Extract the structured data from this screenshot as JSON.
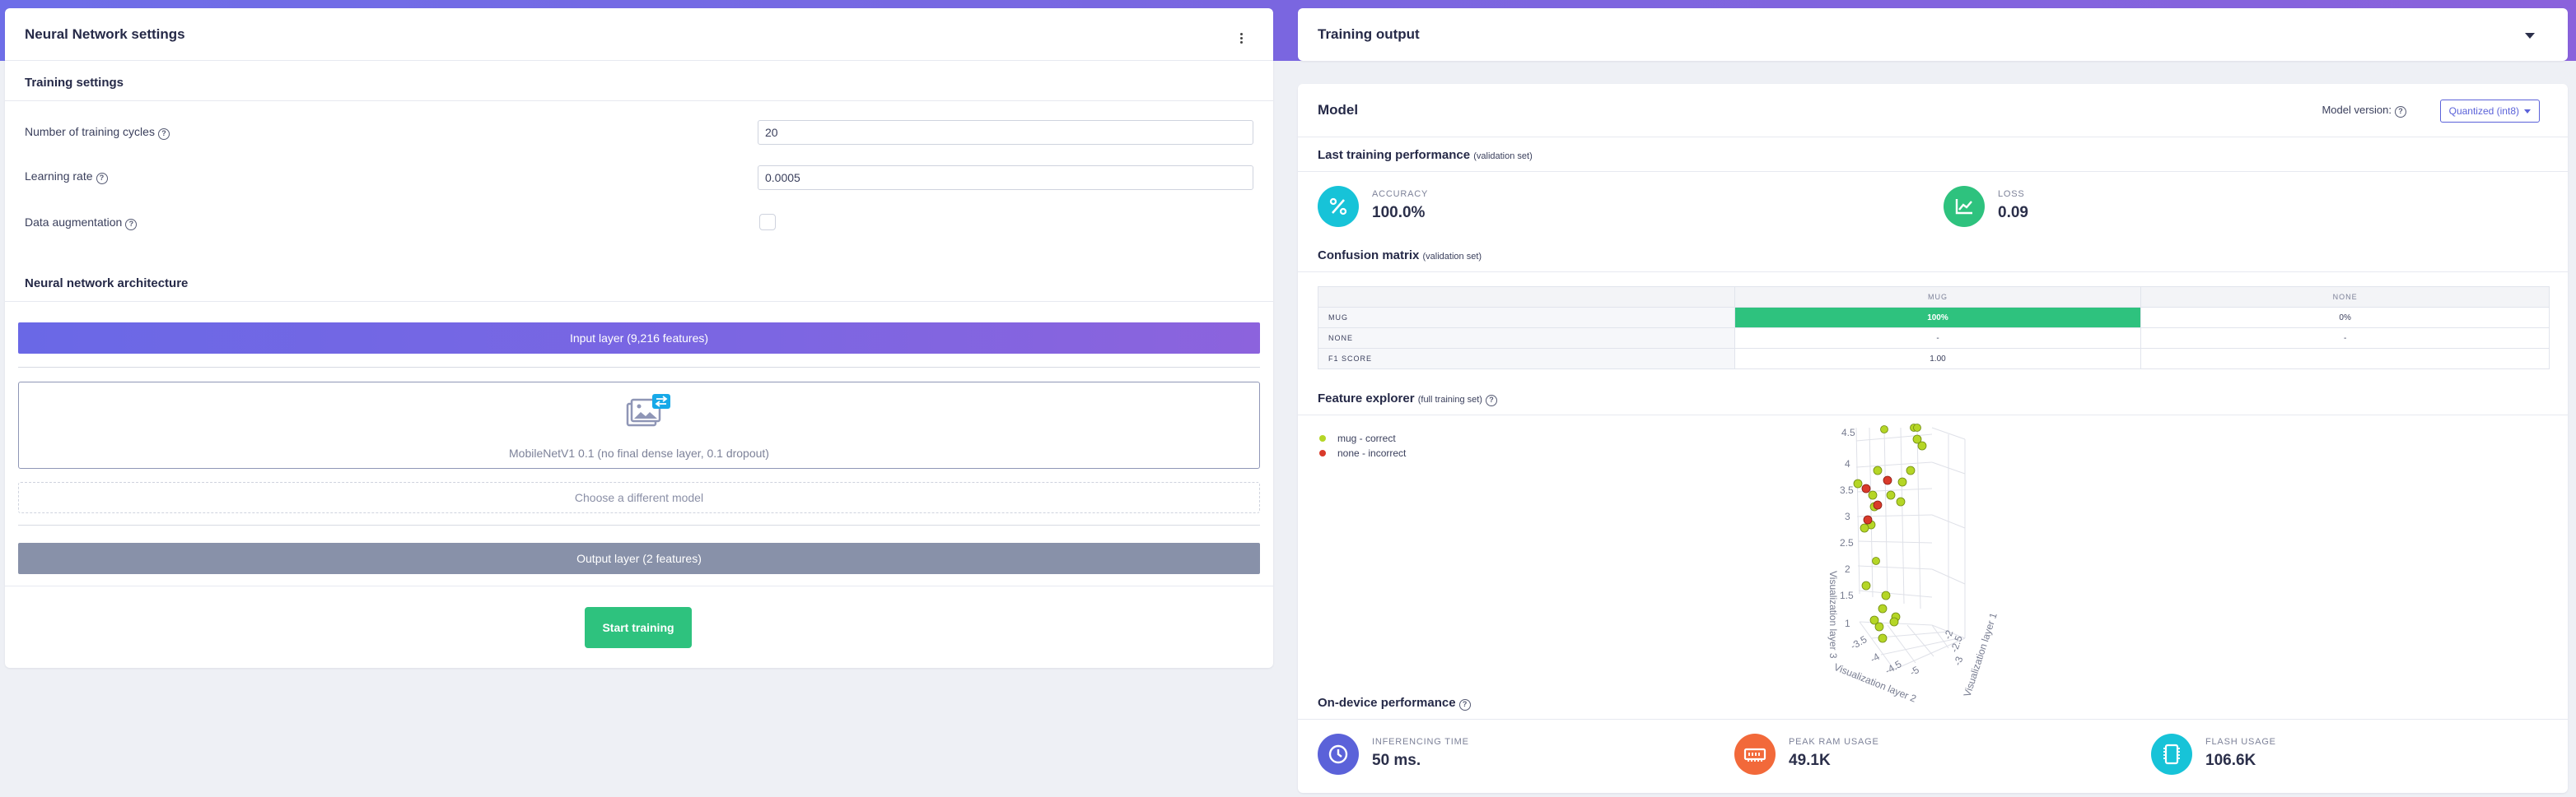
{
  "colors": {
    "accent_purple": "#6e6ee8",
    "green": "#2ec27e",
    "orange": "#f2693a",
    "cyan": "#17c3d8",
    "navy_icon": "#5b62d9",
    "dot_correct": "#b5d626",
    "dot_incorrect": "#d93a2a"
  },
  "nn_settings": {
    "title": "Neural Network settings",
    "menu_icon": "kebab-icon",
    "training_settings_title": "Training settings",
    "fields": [
      {
        "label": "Number of training cycles",
        "value": "20"
      },
      {
        "label": "Learning rate",
        "value": "0.0005"
      },
      {
        "label": "Data augmentation",
        "checked": false
      }
    ],
    "architecture_title": "Neural network architecture",
    "input_layer": "Input layer (9,216 features)",
    "model_name": "MobileNetV1 0.1 (no final dense layer, 0.1 dropout)",
    "choose_model": "Choose a different model",
    "output_layer": "Output layer (2 features)",
    "start_button": "Start training"
  },
  "output": {
    "title": "Training output",
    "model_title": "Model",
    "model_version_label": "Model version:",
    "model_version_value": "Quantized (int8)",
    "last_perf_title": "Last training performance",
    "last_perf_sub": "(validation set)",
    "accuracy_label": "ACCURACY",
    "accuracy_value": "100.0%",
    "loss_label": "LOSS",
    "loss_value": "0.09",
    "confusion_title": "Confusion matrix",
    "confusion_sub": "(validation set)",
    "confusion": {
      "columns": [
        "MUG",
        "NONE"
      ],
      "rows": [
        {
          "label": "MUG",
          "cells": [
            "100%",
            "0%"
          ]
        },
        {
          "label": "NONE",
          "cells": [
            "-",
            "-"
          ]
        },
        {
          "label": "F1 SCORE",
          "cells": [
            "1.00",
            ""
          ]
        }
      ]
    },
    "feature_title": "Feature explorer",
    "feature_sub": "(full training set)",
    "legend": [
      "mug - correct",
      "none - incorrect"
    ],
    "axis_labels": {
      "z": "Visualization layer 3",
      "x": "Visualization layer 2",
      "y": "Visualization layer 1"
    },
    "z_ticks": [
      "4.5",
      "4",
      "3.5",
      "3",
      "2.5",
      "2",
      "1.5",
      "1"
    ],
    "x_ticks": [
      "-3.5",
      "-4",
      "-4.5",
      "-5"
    ],
    "y_ticks": [
      "-2",
      "-2.5",
      "-3"
    ],
    "ondevice_title": "On-device performance",
    "ondevice": [
      {
        "label": "INFERENCING TIME",
        "value": "50 ms.",
        "icon": "clock-icon"
      },
      {
        "label": "PEAK RAM USAGE",
        "value": "49.1K",
        "icon": "ram-icon"
      },
      {
        "label": "FLASH USAGE",
        "value": "106.6K",
        "icon": "flash-chip-icon"
      }
    ]
  }
}
